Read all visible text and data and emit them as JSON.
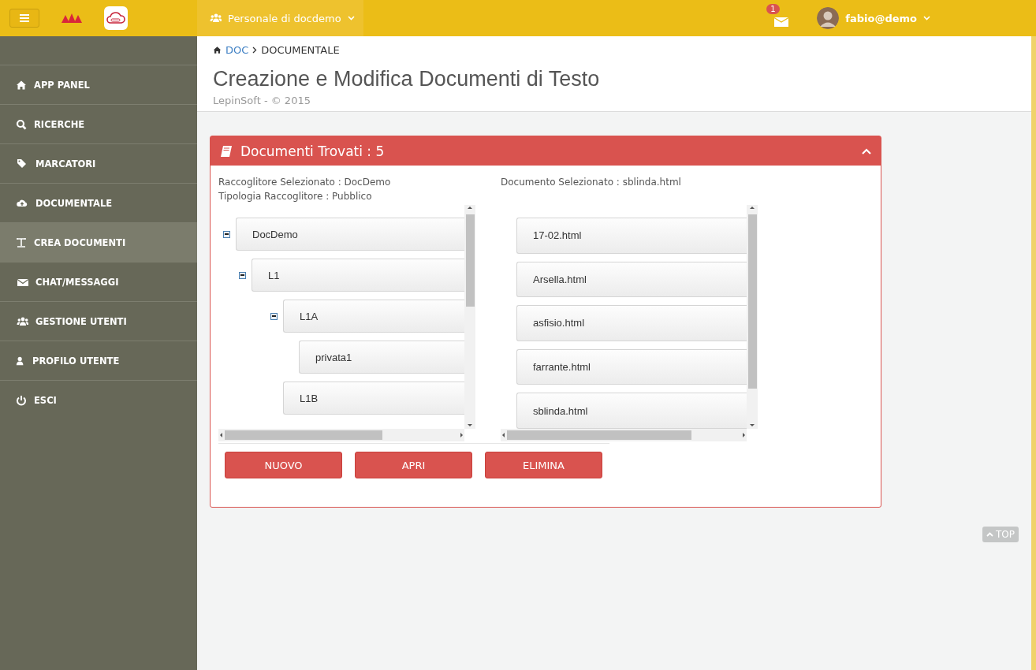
{
  "topbar": {
    "team_menu": "Personale di docdemo",
    "notifications": {
      "count": "1"
    },
    "user_menu": "fabio@demo"
  },
  "sidebar": {
    "items": [
      {
        "label": "APP PANEL",
        "selected": false
      },
      {
        "label": "RICERCHE",
        "selected": false
      },
      {
        "label": "MARCATORI",
        "selected": false
      },
      {
        "label": "DOCUMENTALE",
        "selected": false
      },
      {
        "label": "CREA DOCUMENTI",
        "selected": true
      },
      {
        "label": "CHAT/MESSAGGI",
        "selected": false
      },
      {
        "label": "GESTIONE UTENTI",
        "selected": false
      },
      {
        "label": "PROFILO UTENTE",
        "selected": false
      },
      {
        "label": "ESCI",
        "selected": false
      }
    ]
  },
  "breadcrumb": [
    "DOC",
    "DOCUMENTALE"
  ],
  "page": {
    "title": "Creazione e Modifica Documenti di Testo",
    "subtitle": "LepinSoft - © 2015"
  },
  "panel": {
    "title": "Documenti Trovati : 5",
    "info_left": [
      "Raccoglitore Selezionato : DocDemo",
      "Tipologia Raccoglitore : Pubblico"
    ],
    "info_right": "Documento Selezionato : sblinda.html",
    "tree": [
      {
        "label": "DocDemo",
        "expanded": true,
        "children": [
          {
            "label": "L1",
            "expanded": true,
            "children": [
              {
                "label": "L1A",
                "expanded": true,
                "children": [
                  {
                    "label": "privata1"
                  }
                ]
              },
              {
                "label": "L1B"
              }
            ]
          }
        ]
      }
    ],
    "documents": [
      "17-02.html",
      "Arsella.html",
      "asfisio.html",
      "farrante.html",
      "sblinda.html"
    ],
    "buttons": [
      "NUOVO",
      "APRI",
      "ELIMINA"
    ]
  },
  "top_button": "TOP"
}
